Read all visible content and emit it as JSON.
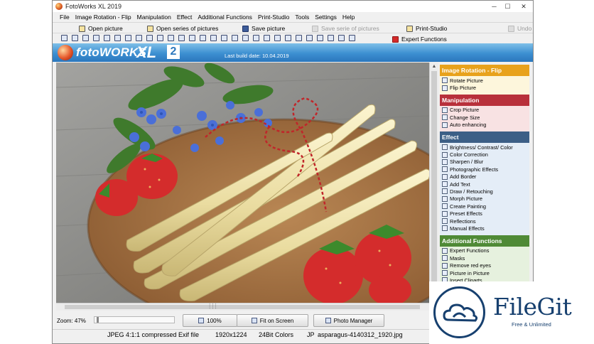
{
  "window": {
    "title": "FotoWorks XL 2019",
    "controls": [
      "─",
      "☐",
      "✕"
    ]
  },
  "menu": [
    "File",
    "Image Rotation - Flip",
    "Manipulation",
    "Effect",
    "Additional Functions",
    "Print-Studio",
    "Tools",
    "Settings",
    "Help"
  ],
  "toolbar": {
    "open_picture": "Open picture",
    "open_series": "Open series of pictures",
    "save_picture": "Save picture",
    "save_series": "Save serie of pictures",
    "print_studio": "Print-Studio",
    "expert_functions": "Expert Functions",
    "undo": "Undo"
  },
  "header": {
    "logo_text": "fotoWORKS",
    "logo_xl": "XL",
    "logo_version": "2",
    "build_date": "Last build date: 10.04.2019"
  },
  "sidebar": {
    "sections": [
      {
        "title": "Image Rotation - Flip",
        "color": "#e8a21c",
        "bg": "#fdf6dc",
        "items": [
          "Rotate Picture",
          "Flip Picture"
        ]
      },
      {
        "title": "Manipulation",
        "color": "#b8303b",
        "bg": "#f8e2e3",
        "items": [
          "Crop Picture",
          "Change Size",
          "Auto enhancing"
        ]
      },
      {
        "title": "Effect",
        "color": "#3c5f86",
        "bg": "#e4edf7",
        "items": [
          "Brightness/ Contrast/ Color",
          "Color Correction",
          "Sharpen / Blur",
          "Photographic Effects",
          "Add Border",
          "Add Text",
          "Draw / Retouching",
          "Morph Picture",
          "Create Painting",
          "Preset Effects",
          "Reflections",
          "Manual Effects"
        ]
      },
      {
        "title": "Additional Functions",
        "color": "#4f8a36",
        "bg": "#e6f1de",
        "items": [
          "Expert Functions",
          "Masks",
          "Remove red eyes",
          "Picture in Picture",
          "Insert Cliparts"
        ]
      }
    ]
  },
  "bottom": {
    "zoom_label": "Zoom: 47%",
    "zoom_fraction": 0.47,
    "btn_100": "100%",
    "btn_fit": "Fit on Screen",
    "btn_manager": "Photo Manager"
  },
  "status": {
    "format": "JPEG 4:1:1 compressed Exif file",
    "size": "1920x1224",
    "colors": "24Bit Colors",
    "jp": "JP",
    "filename": "asparagus-4140312_1920.jpg"
  },
  "watermark": {
    "name": "FileGit",
    "tagline": "Free & Unlimited"
  }
}
